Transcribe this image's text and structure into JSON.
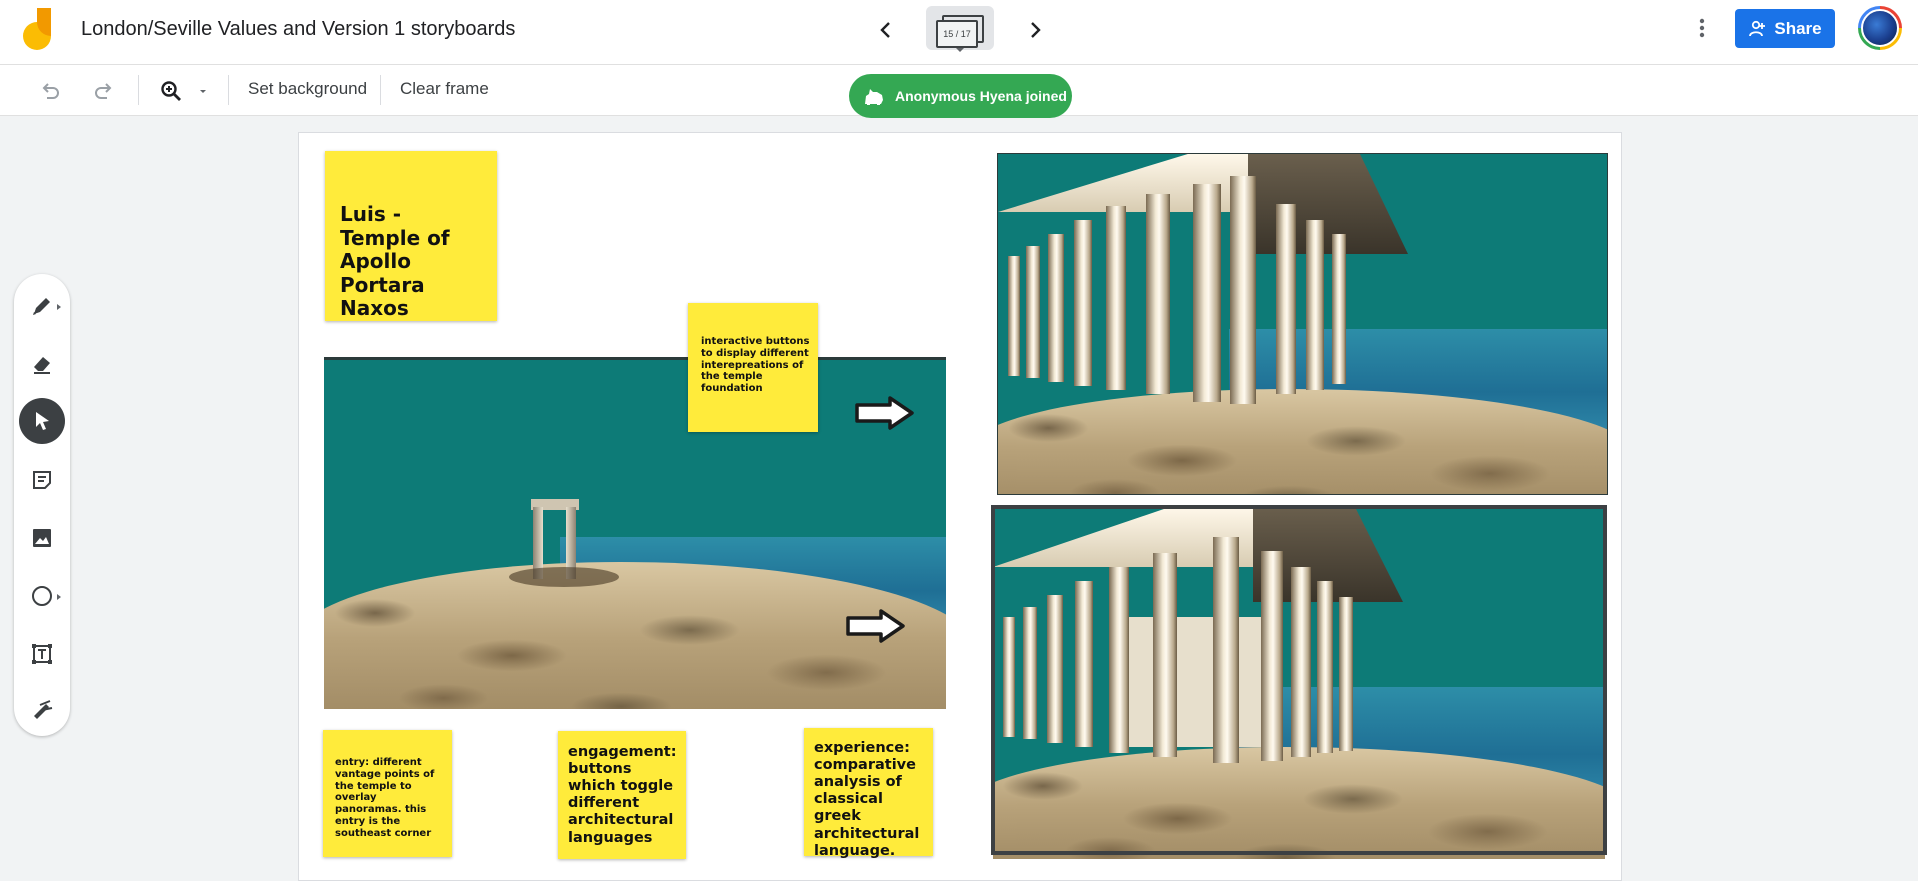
{
  "header": {
    "title": "London/Seville Values and Version 1 storyboards",
    "frame_counter": "15 / 17",
    "share_label": "Share"
  },
  "toolbar": {
    "set_background_label": "Set background",
    "clear_frame_label": "Clear frame"
  },
  "notification": {
    "text": "Anonymous Hyena joined"
  },
  "rail_tools": [
    "pen-icon",
    "eraser-icon",
    "select-icon",
    "sticky-note-icon",
    "image-icon",
    "circle-icon",
    "text-box-icon",
    "laser-icon"
  ],
  "canvas": {
    "sticky_title": "Luis - Temple of Apollo Portara Naxos",
    "sticky_buttons": "interactive buttons to display different interepreations of the temple foundation",
    "sticky_entry": "entry: different vantage points of the temple to overlay panoramas. this entry is the southeast corner",
    "sticky_engagement": "engagement: buttons which toggle different architectural languages",
    "sticky_experience": "experience: comparative analysis of classical greek architectural language."
  },
  "colors": {
    "accent": "#1a73e8",
    "toast": "#34a853",
    "sticky": "#ffeb3b",
    "sky": "#0d7b77"
  }
}
